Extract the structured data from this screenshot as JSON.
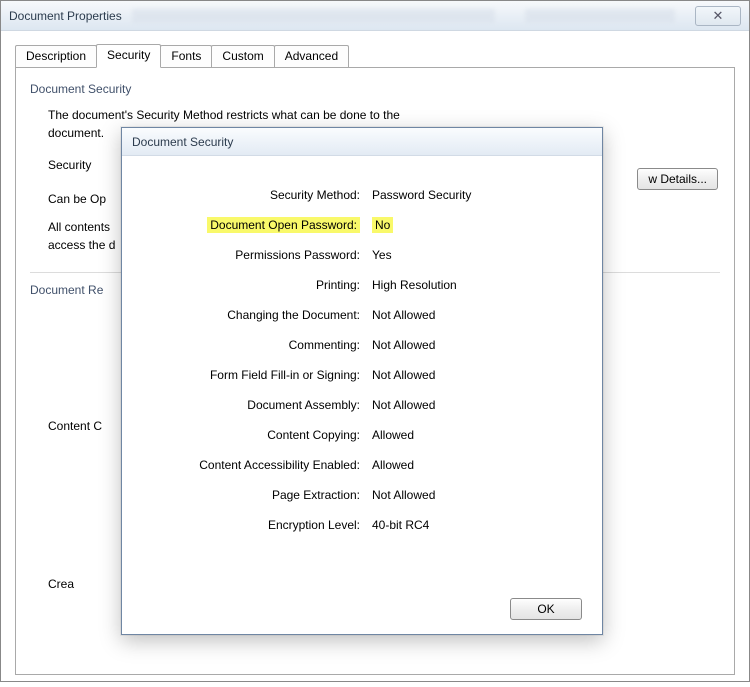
{
  "window": {
    "title": "Document Properties",
    "close_glyph": "✕"
  },
  "tabs": {
    "description": "Description",
    "security": "Security",
    "fonts": "Fonts",
    "custom": "Custom",
    "advanced": "Advanced",
    "active": "security"
  },
  "security_panel": {
    "group1_title": "Document Security",
    "intro_line1": "The document's Security Method restricts what can be done to the",
    "intro_line2": "document.",
    "security_label": "Security",
    "can_be_opened": "Can be Op",
    "all_contents": "All contents",
    "access_doc": "access the d",
    "show_details": "w Details...",
    "group2_title": "Document Re",
    "content_c": "Content C",
    "crea": "Crea"
  },
  "modal": {
    "title": "Document Security",
    "rows": [
      {
        "label": "Security Method:",
        "value": "Password Security",
        "highlight": false
      },
      {
        "label": "Document Open Password:",
        "value": "No",
        "highlight": true
      },
      {
        "label": "Permissions Password:",
        "value": "Yes",
        "highlight": false
      },
      {
        "label": "Printing:",
        "value": "High Resolution",
        "highlight": false
      },
      {
        "label": "Changing the Document:",
        "value": "Not Allowed",
        "highlight": false
      },
      {
        "label": "Commenting:",
        "value": "Not Allowed",
        "highlight": false
      },
      {
        "label": "Form Field Fill-in or Signing:",
        "value": "Not Allowed",
        "highlight": false
      },
      {
        "label": "Document Assembly:",
        "value": "Not Allowed",
        "highlight": false
      },
      {
        "label": "Content Copying:",
        "value": "Allowed",
        "highlight": false
      },
      {
        "label": "Content Accessibility Enabled:",
        "value": "Allowed",
        "highlight": false
      },
      {
        "label": "Page Extraction:",
        "value": "Not Allowed",
        "highlight": false
      },
      {
        "label": "Encryption Level:",
        "value": "40-bit RC4",
        "highlight": false
      }
    ],
    "ok": "OK"
  }
}
